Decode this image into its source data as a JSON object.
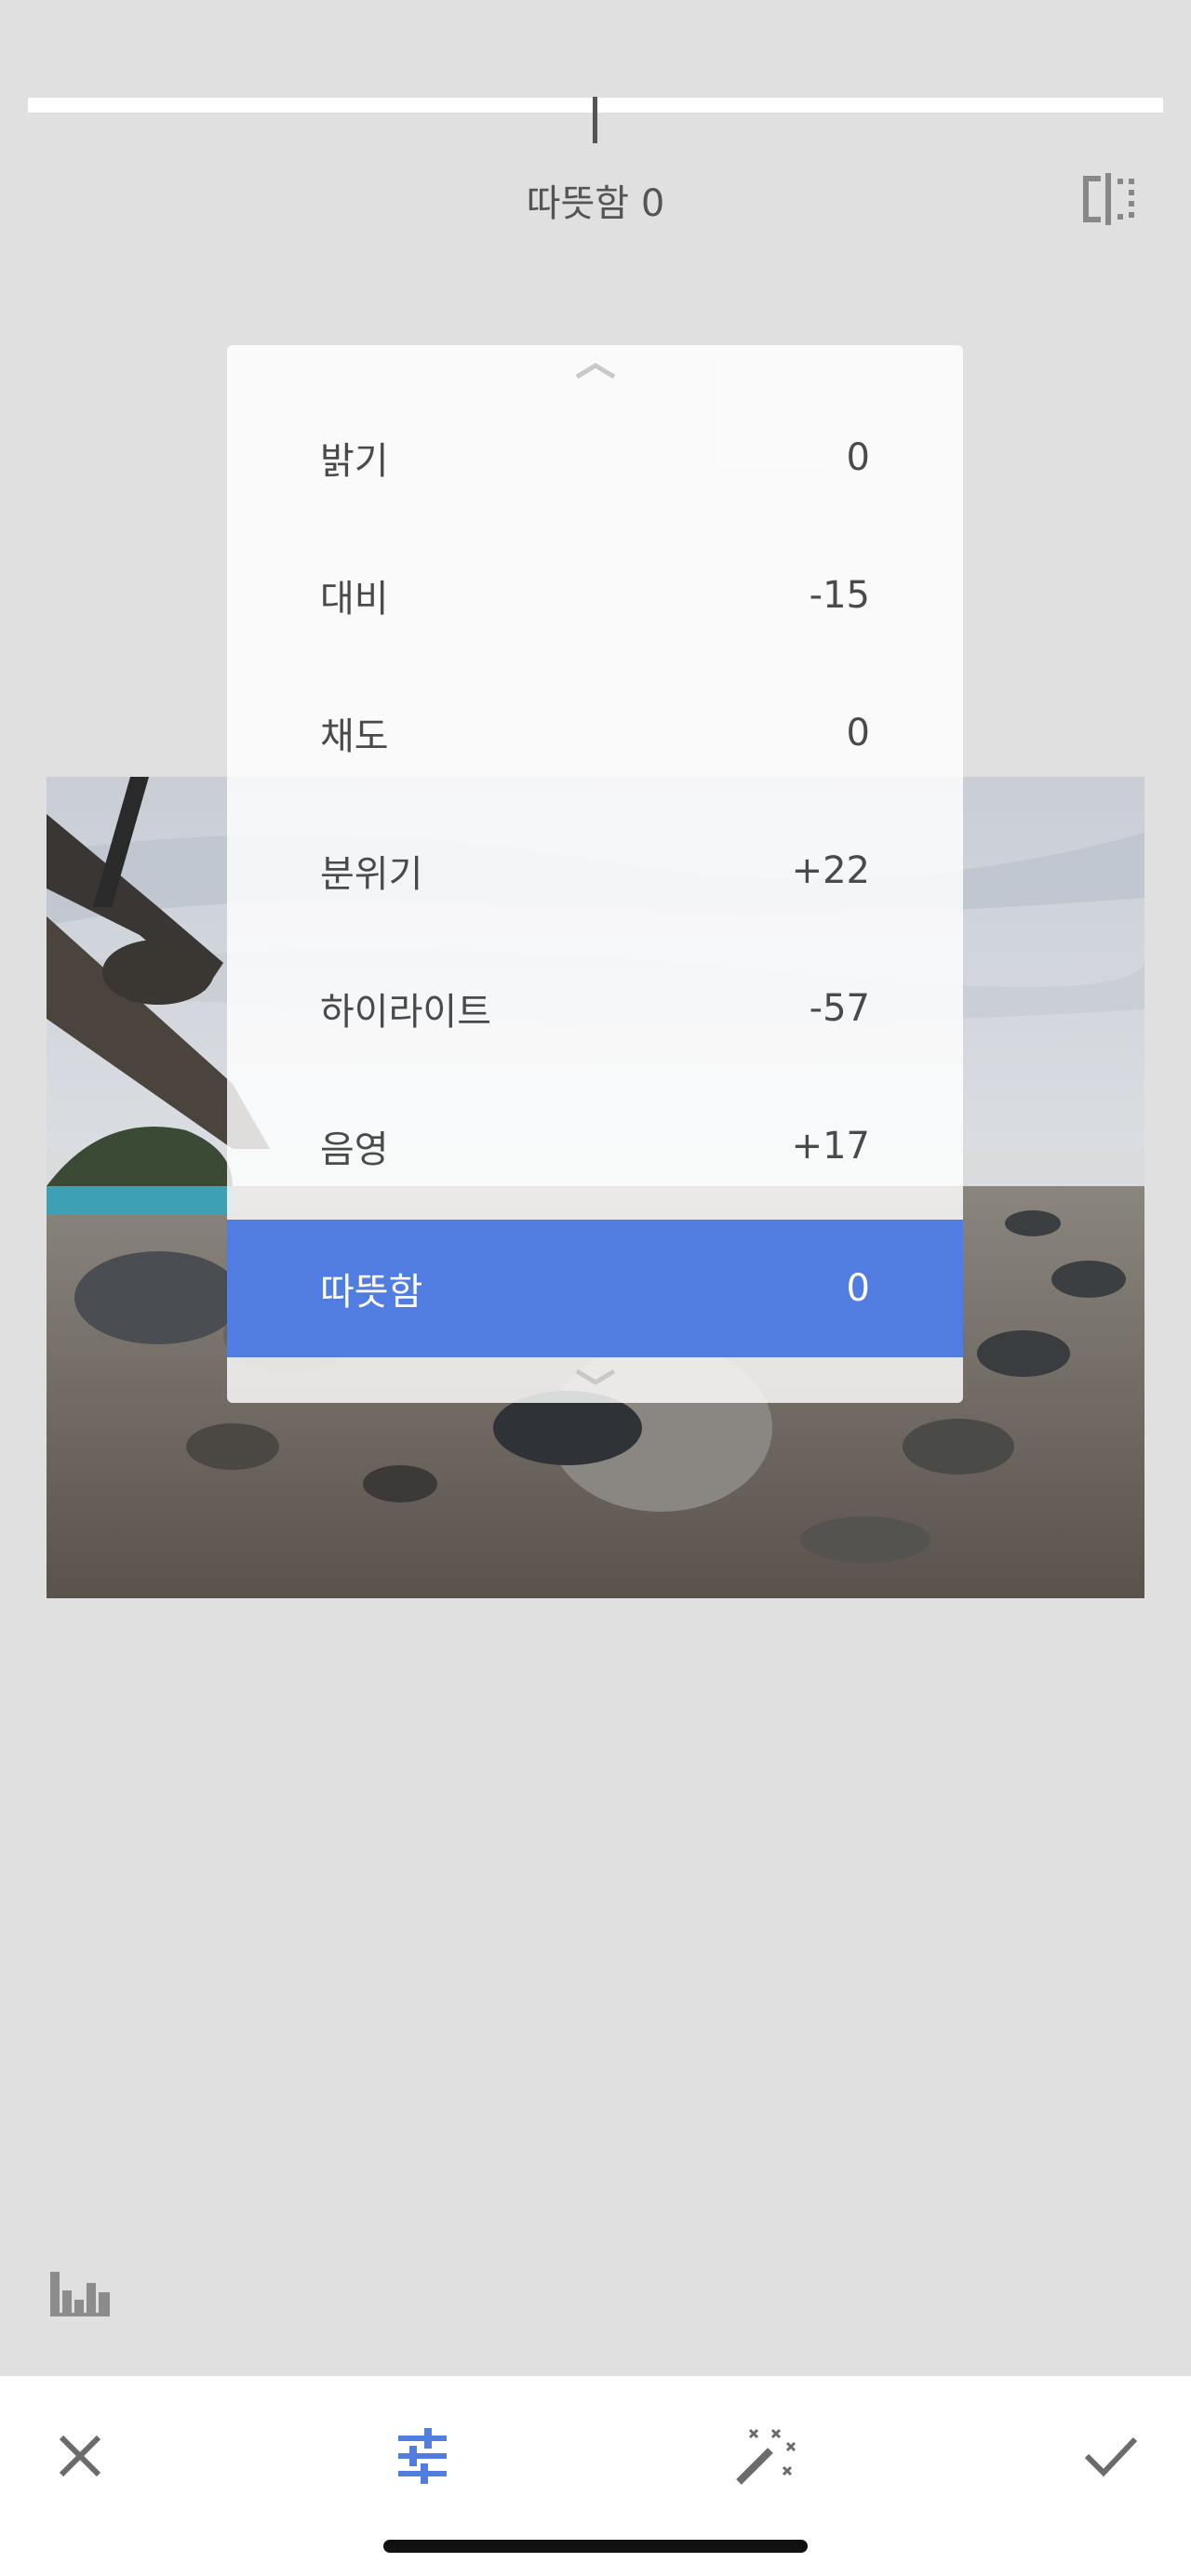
{
  "top_slider": {
    "value": 0
  },
  "readout": {
    "text": "따뜻함 0"
  },
  "menu": {
    "items": [
      {
        "label": "밝기",
        "value": "0"
      },
      {
        "label": "대비",
        "value": "-15"
      },
      {
        "label": "채도",
        "value": "0"
      },
      {
        "label": "분위기",
        "value": "+22"
      },
      {
        "label": "하이라이트",
        "value": "-57"
      },
      {
        "label": "음영",
        "value": "+17"
      },
      {
        "label": "따뜻함",
        "value": "0",
        "selected": true
      }
    ]
  },
  "icons": {
    "compare": "compare-icon",
    "histogram": "histogram-icon",
    "menu_up": "chevron-up-icon",
    "menu_down": "chevron-down-icon",
    "cancel": "close-icon",
    "adjust": "sliders-icon",
    "auto": "magic-wand-icon",
    "apply": "check-icon"
  },
  "colors": {
    "accent": "#527de0",
    "background": "#e0e0e0",
    "bottom_bar": "#ffffff"
  }
}
